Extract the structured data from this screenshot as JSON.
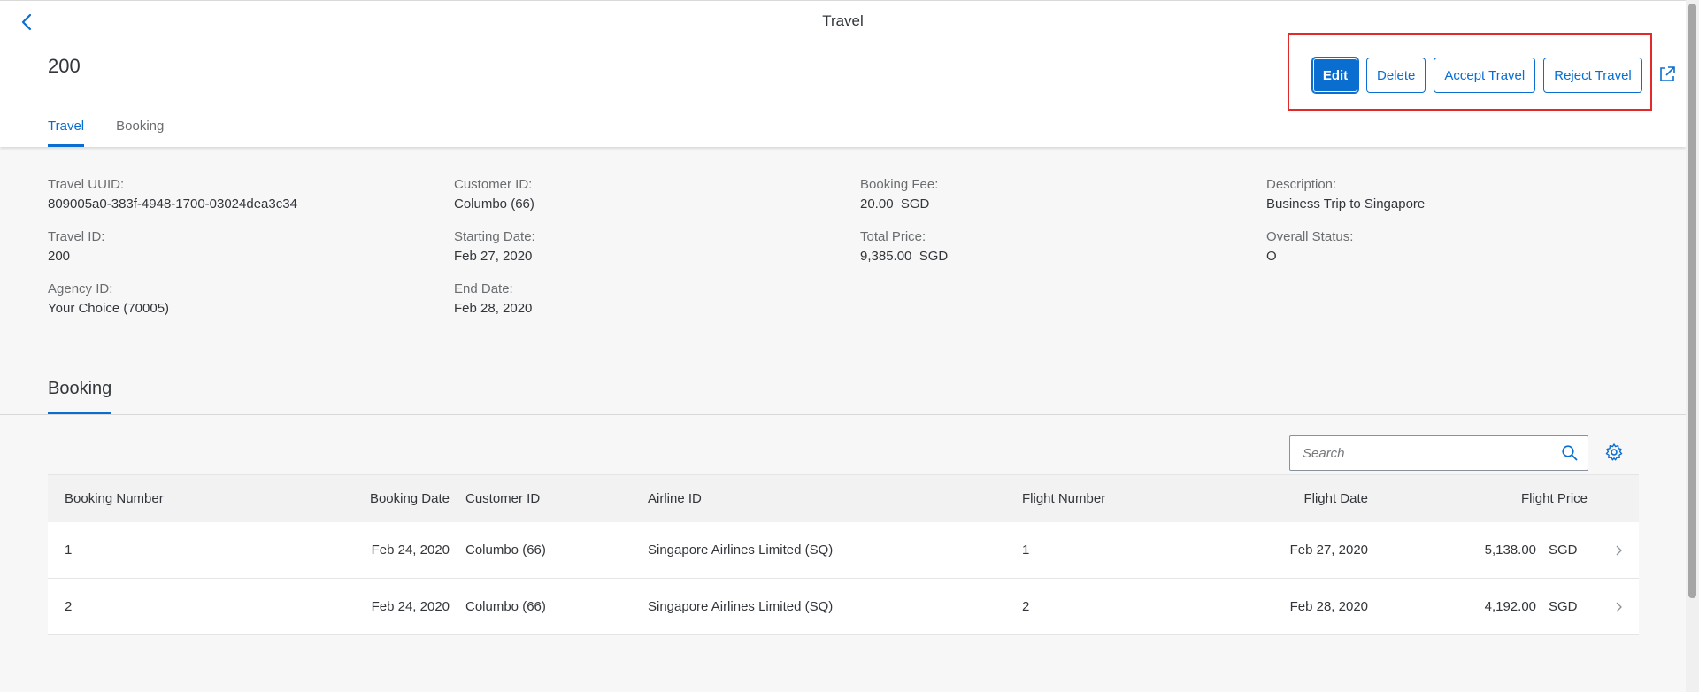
{
  "shell": {
    "title": "Travel"
  },
  "header": {
    "object_title": "200",
    "tabs": [
      {
        "label": "Travel"
      },
      {
        "label": "Booking"
      }
    ],
    "actions": {
      "edit": "Edit",
      "delete": "Delete",
      "accept": "Accept Travel",
      "reject": "Reject Travel"
    }
  },
  "details": {
    "col1": [
      {
        "label": "Travel UUID:",
        "value": "809005a0-383f-4948-1700-03024dea3c34"
      },
      {
        "label": "Travel ID:",
        "value": "200"
      },
      {
        "label": "Agency ID:",
        "value": "Your Choice (70005)"
      }
    ],
    "col2": [
      {
        "label": "Customer ID:",
        "value": "Columbo (66)"
      },
      {
        "label": "Starting Date:",
        "value": "Feb 27, 2020"
      },
      {
        "label": "End Date:",
        "value": "Feb 28, 2020"
      }
    ],
    "col3": [
      {
        "label": "Booking Fee:",
        "value": "20.00  SGD"
      },
      {
        "label": "Total Price:",
        "value": "9,385.00  SGD"
      }
    ],
    "col4": [
      {
        "label": "Description:",
        "value": "Business Trip to Singapore"
      },
      {
        "label": "Overall Status:",
        "value": "O"
      }
    ]
  },
  "booking": {
    "section_title": "Booking",
    "search_placeholder": "Search",
    "columns": {
      "booking_number": "Booking Number",
      "booking_date": "Booking Date",
      "customer_id": "Customer ID",
      "airline_id": "Airline ID",
      "flight_number": "Flight Number",
      "flight_date": "Flight Date",
      "flight_price": "Flight Price"
    },
    "rows": [
      {
        "booking_number": "1",
        "booking_date": "Feb 24, 2020",
        "customer_id": "Columbo (66)",
        "airline_id": "Singapore Airlines Limited (SQ)",
        "flight_number": "1",
        "flight_date": "Feb 27, 2020",
        "price": "5,138.00",
        "currency": "SGD"
      },
      {
        "booking_number": "2",
        "booking_date": "Feb 24, 2020",
        "customer_id": "Columbo (66)",
        "airline_id": "Singapore Airlines Limited (SQ)",
        "flight_number": "2",
        "flight_date": "Feb 28, 2020",
        "price": "4,192.00",
        "currency": "SGD"
      }
    ]
  },
  "colors": {
    "accent": "#0a6ed1",
    "highlight_box": "#e32a2a",
    "background": "#f7f7f7"
  },
  "icons": {
    "back": "chevron-left-icon",
    "share": "share-icon",
    "search": "search-icon",
    "settings": "gear-icon",
    "row_nav": "chevron-right-icon"
  }
}
